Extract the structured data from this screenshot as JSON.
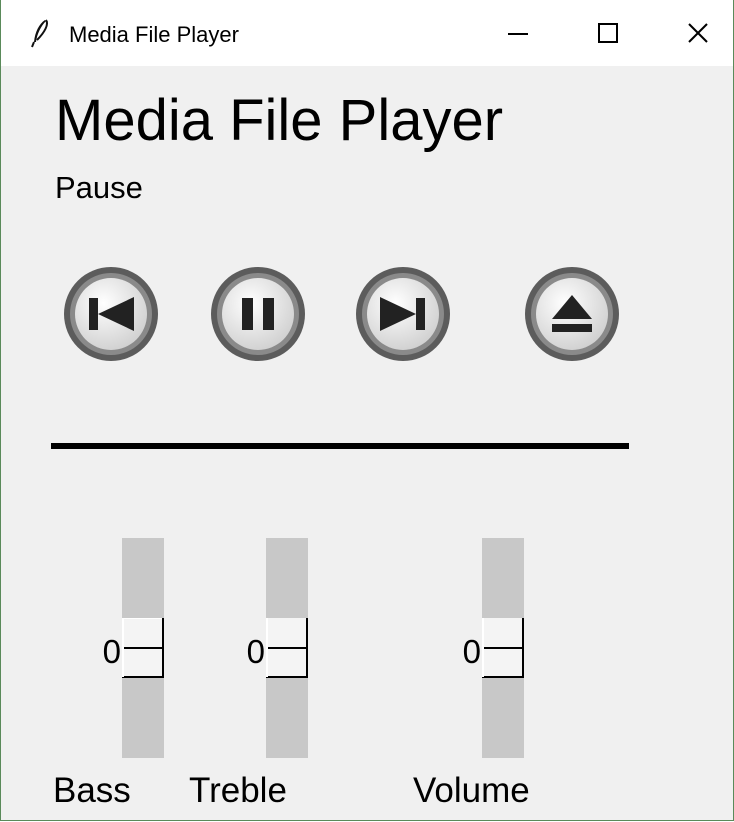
{
  "window": {
    "title": "Media File Player",
    "app_icon": "feather-icon",
    "buttons": [
      "minimize-icon",
      "maximize-icon",
      "close-icon"
    ]
  },
  "player": {
    "title": "Media File Player",
    "status": "Pause"
  },
  "controls": [
    {
      "name": "previous-button",
      "icon": "skip-previous-icon"
    },
    {
      "name": "pause-button",
      "icon": "pause-icon"
    },
    {
      "name": "next-button",
      "icon": "skip-next-icon"
    },
    {
      "name": "eject-button",
      "icon": "eject-icon"
    }
  ],
  "sliders": {
    "bass": {
      "label": "Bass",
      "value": "0"
    },
    "treble": {
      "label": "Treble",
      "value": "0"
    },
    "volume": {
      "label": "Volume",
      "value": "0"
    }
  },
  "colors": {
    "window_bg": "#f0f0f0",
    "titlebar_bg": "#ffffff",
    "trough": "#c8c8c8",
    "button_ring": "#5c5c5c"
  }
}
